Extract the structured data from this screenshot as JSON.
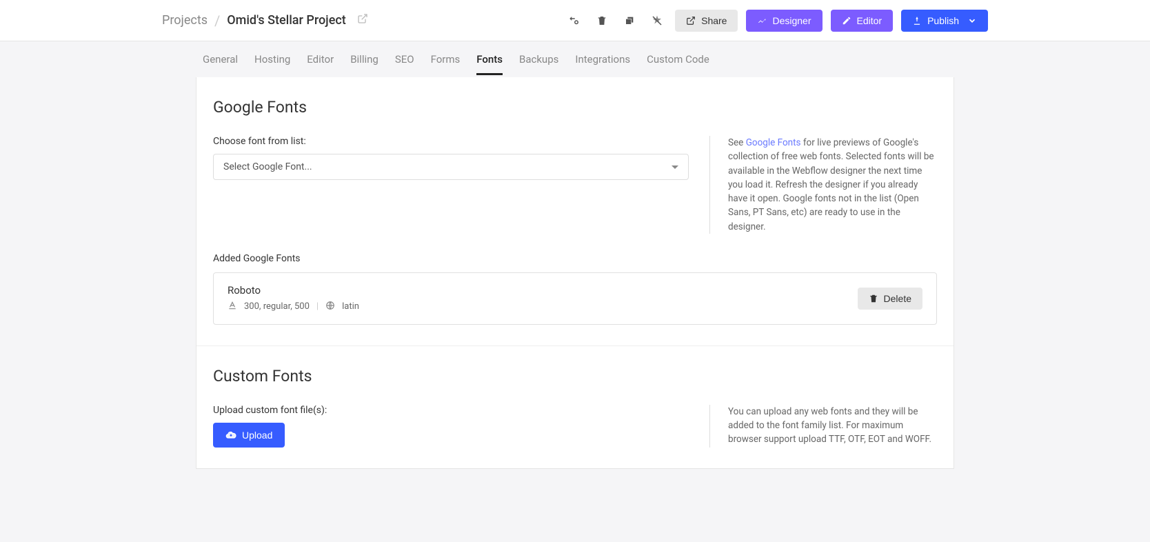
{
  "breadcrumb": {
    "root": "Projects",
    "project": "Omid's Stellar Project"
  },
  "actions": {
    "share": "Share",
    "designer": "Designer",
    "editor": "Editor",
    "publish": "Publish"
  },
  "tabs": [
    "General",
    "Hosting",
    "Editor",
    "Billing",
    "SEO",
    "Forms",
    "Fonts",
    "Backups",
    "Integrations",
    "Custom Code"
  ],
  "activeTab": "Fonts",
  "googleFonts": {
    "heading": "Google Fonts",
    "chooseLabel": "Choose font from list:",
    "selectPlaceholder": "Select Google Font...",
    "helpPrefix": "See ",
    "helpLink": "Google Fonts",
    "helpSuffix": " for live previews of Google's collection of free web fonts. Selected fonts will be available in the Webflow designer the next time you load it. Refresh the designer if you already have it open. Google fonts not in the list (Open Sans, PT Sans, etc) are ready to use in the designer.",
    "addedLabel": "Added Google Fonts",
    "added": [
      {
        "name": "Roboto",
        "weights": "300, regular, 500",
        "script": "latin"
      }
    ],
    "deleteLabel": "Delete"
  },
  "customFonts": {
    "heading": "Custom Fonts",
    "uploadLabel": "Upload custom font file(s):",
    "uploadButton": "Upload",
    "help": "You can upload any web fonts and they will be added to the font family list. For maximum browser support upload TTF, OTF, EOT and WOFF."
  }
}
